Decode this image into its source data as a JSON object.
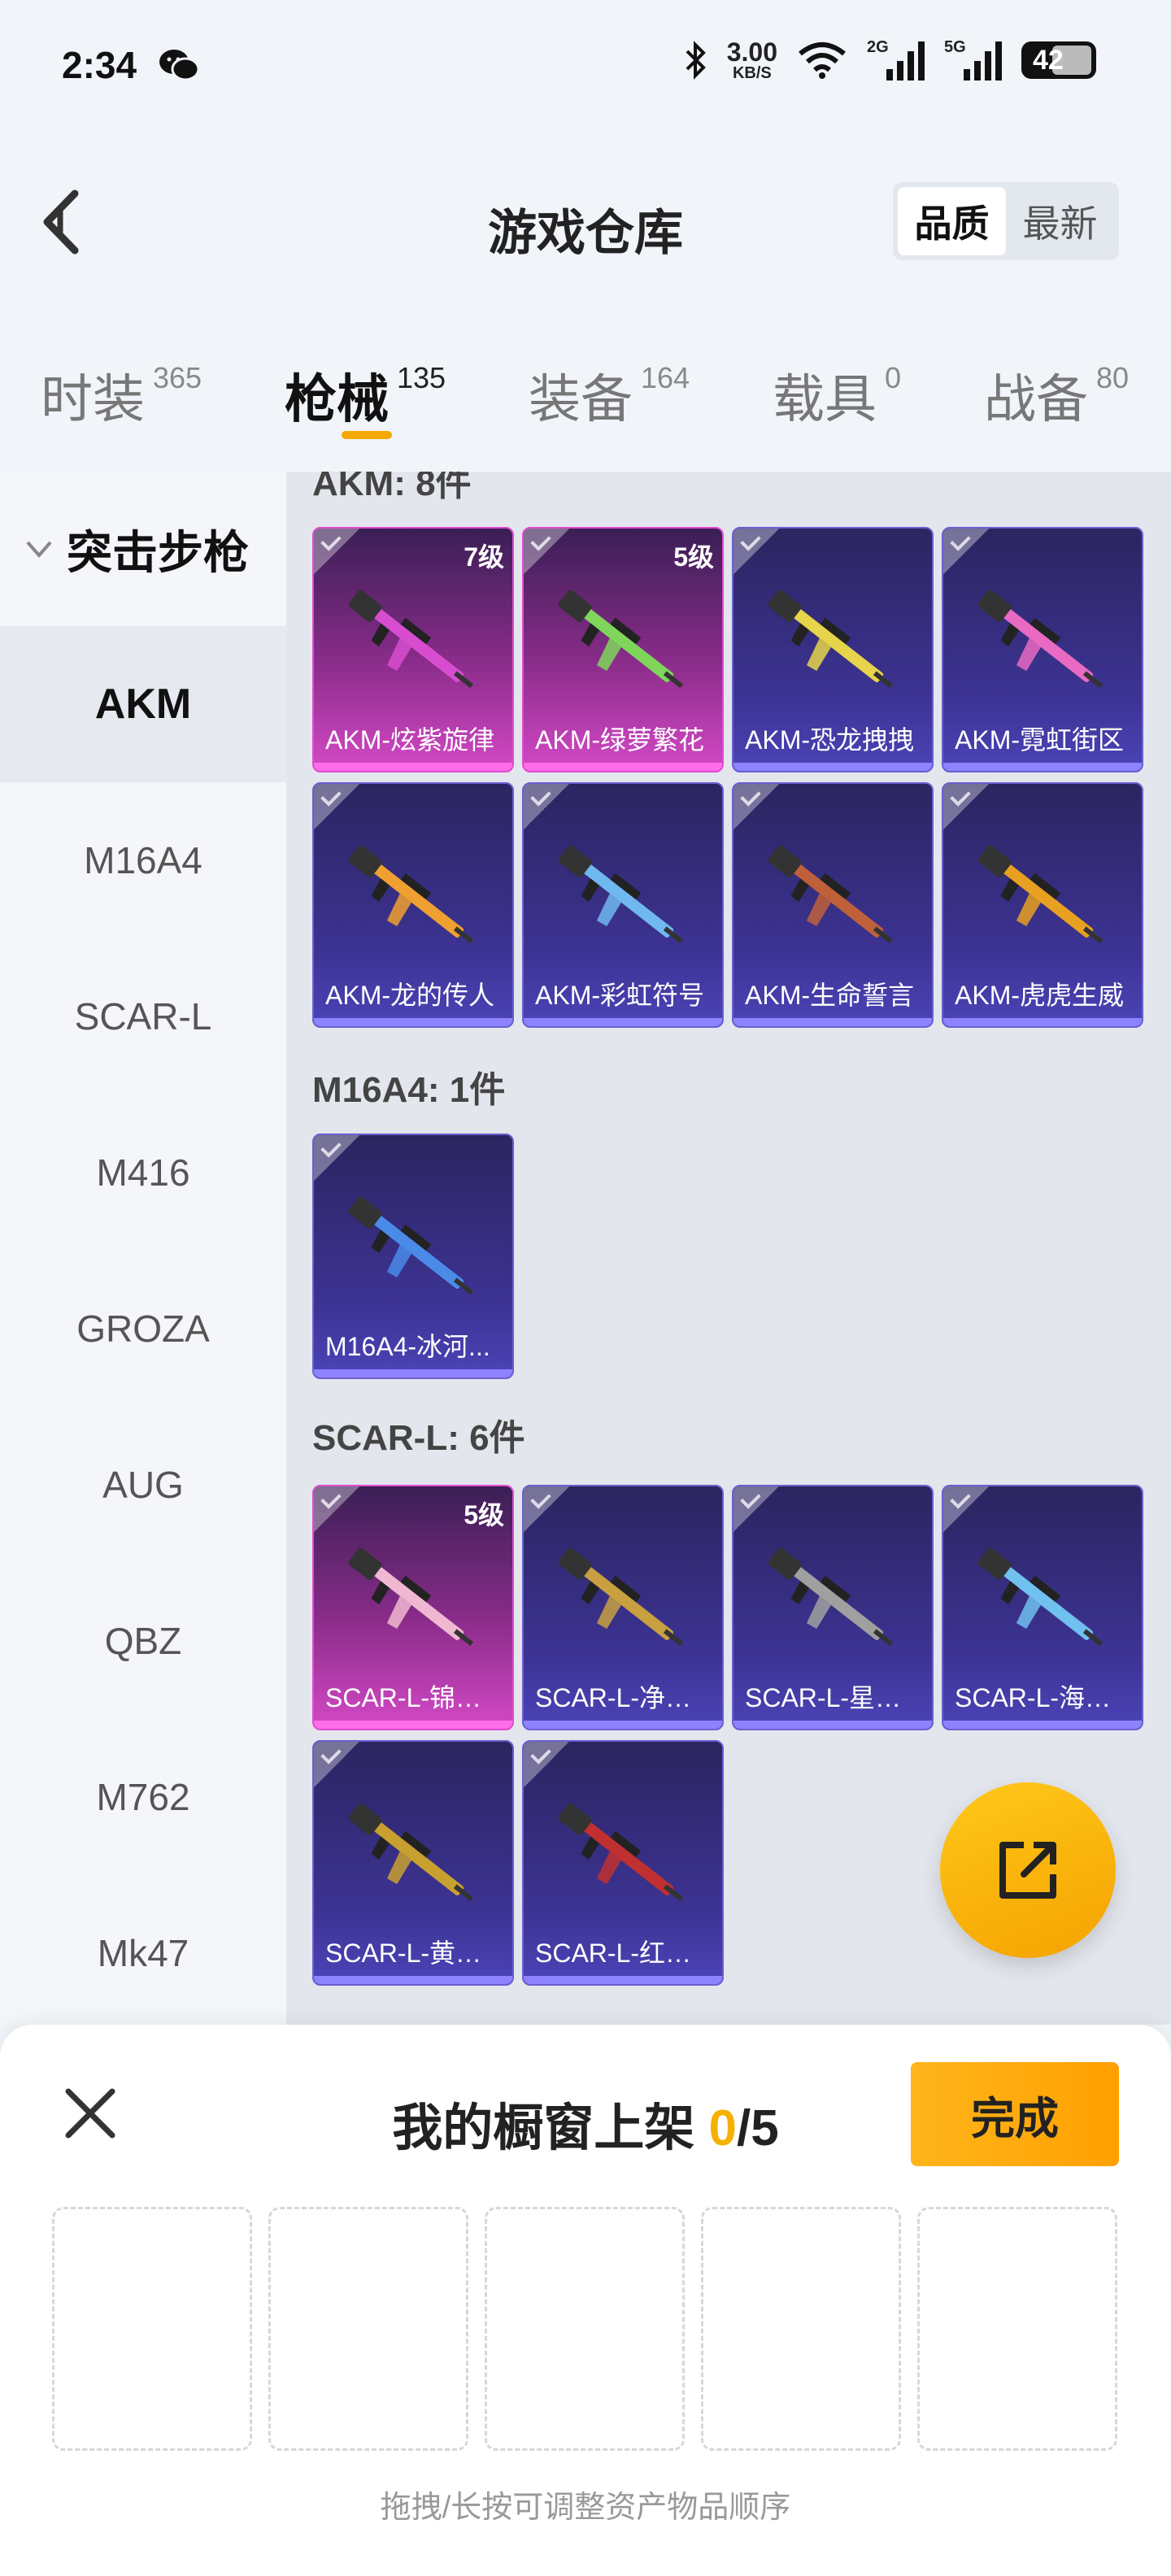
{
  "status_bar": {
    "time": "2:34",
    "speed_value": "3.00",
    "speed_unit": "KB/S",
    "net1": "2G",
    "net2": "5G",
    "battery": "42"
  },
  "header": {
    "title": "游戏仓库",
    "sort_options": [
      "品质",
      "最新"
    ],
    "active_sort": "品质"
  },
  "tabs": [
    {
      "name": "时装",
      "count": "365"
    },
    {
      "name": "枪械",
      "count": "135"
    },
    {
      "name": "装备",
      "count": "164"
    },
    {
      "name": "载具",
      "count": "0"
    },
    {
      "name": "战备",
      "count": "80"
    }
  ],
  "sidebar": {
    "category": "突击步枪",
    "items": [
      "AKM",
      "M16A4",
      "SCAR-L",
      "M416",
      "GROZA",
      "AUG",
      "QBZ",
      "M762",
      "Mk47"
    ]
  },
  "sections": [
    {
      "title": "AKM: 8件",
      "items": [
        {
          "name": "AKM-炫紫旋律",
          "level": "7级",
          "rarity": "pink"
        },
        {
          "name": "AKM-绿萝繁花",
          "level": "5级",
          "rarity": "pink"
        },
        {
          "name": "AKM-恐龙拽拽",
          "level": "",
          "rarity": "purple"
        },
        {
          "name": "AKM-霓虹街区",
          "level": "",
          "rarity": "purple"
        },
        {
          "name": "AKM-龙的传人",
          "level": "",
          "rarity": "purple"
        },
        {
          "name": "AKM-彩虹符号",
          "level": "",
          "rarity": "purple"
        },
        {
          "name": "AKM-生命誓言",
          "level": "",
          "rarity": "purple"
        },
        {
          "name": "AKM-虎虎生威",
          "level": "",
          "rarity": "purple"
        }
      ]
    },
    {
      "title": "M16A4: 1件",
      "items": [
        {
          "name": "M16A4-冰河...",
          "level": "",
          "rarity": "purple"
        }
      ]
    },
    {
      "title": "SCAR-L: 6件",
      "items": [
        {
          "name": "SCAR-L-锦绣...",
          "level": "5级",
          "rarity": "pink"
        },
        {
          "name": "SCAR-L-净心...",
          "level": "",
          "rarity": "purple"
        },
        {
          "name": "SCAR-L-星途...",
          "level": "",
          "rarity": "purple"
        },
        {
          "name": "SCAR-L-海盐...",
          "level": "",
          "rarity": "purple"
        },
        {
          "name": "SCAR-L-黄金...",
          "level": "",
          "rarity": "purple"
        },
        {
          "name": "SCAR-L-红色...",
          "level": "",
          "rarity": "purple"
        }
      ]
    }
  ],
  "panel": {
    "title": "我的橱窗上架",
    "current": "0",
    "max": "/5",
    "done_label": "完成",
    "hint": "拖拽/长按可调整资产物品顺序"
  },
  "colors": {
    "accent": "#f5a800",
    "pink_rarity": "#e14bd0",
    "purple_rarity": "#6a5fd0"
  }
}
